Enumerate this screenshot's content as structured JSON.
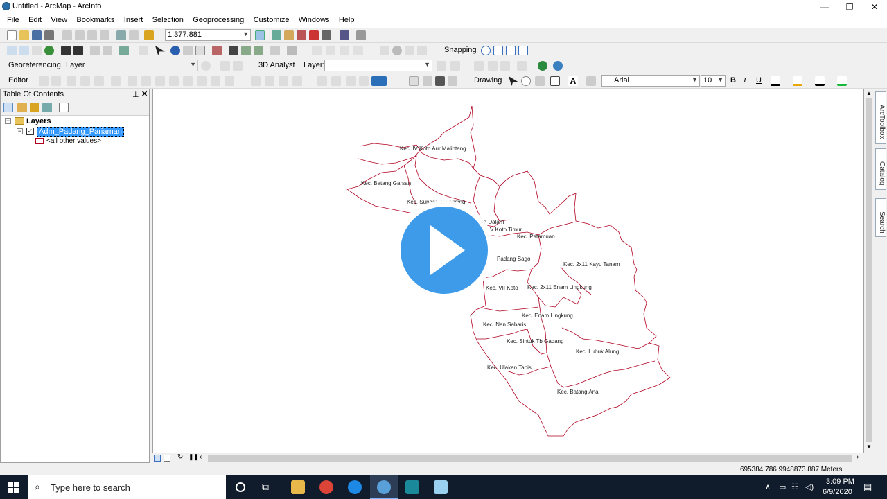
{
  "window": {
    "title": "Untitled - ArcMap - ArcInfo",
    "min": "—",
    "max": "❐",
    "close": "✕"
  },
  "menu": [
    "File",
    "Edit",
    "View",
    "Bookmarks",
    "Insert",
    "Selection",
    "Geoprocessing",
    "Customize",
    "Windows",
    "Help"
  ],
  "toolbar": {
    "scale": "1:377.881",
    "snapping_label": "Snapping",
    "georef_label": "Georeferencing",
    "layer_label": "Layer:",
    "analyst_label": "3D Analyst",
    "layer2_label": "Layer:",
    "editor_label": "Editor",
    "drawing_label": "Drawing",
    "font_name": "Arial",
    "font_size": "10",
    "bold": "B",
    "italic": "I",
    "underline": "U"
  },
  "toc": {
    "title": "Table Of Contents",
    "root": "Layers",
    "layer": "Adm_Padang_Pariaman",
    "legend": "<all other values>"
  },
  "dock_tabs": [
    "ArcToolbox",
    "Catalog",
    "Search"
  ],
  "map": {
    "labels": [
      "Kec. IV Koto Aur Malintang",
      "Kec. Batang Gasan",
      "Kec. Sungai Geringging",
      "Kec. V Koto Dalam",
      "Kec. V Koto Timur",
      "Kec. Patamuan",
      "Kec. Padang Sago",
      "Kec. 2x11 Kayu Tanam",
      "Kec. VII Koto",
      "Kec. 2x11 Enam Lingkung",
      "Kec. Enam Lingkung",
      "Kec. Nan Sabaris",
      "Kec. Sintuk Tb Gadang",
      "Kec. Lubuk Alung",
      "Kec. Ulakan Tapis",
      "Kec. Batang Anai"
    ],
    "label_visible": [
      "Kec. IV Koto Aur Malintang",
      "Kec. Batang Garsan",
      "Kec. Sungai Geringging",
      "oto Dalam",
      "V Koto Timur",
      "Kec. Patamuan",
      "Padang Sago",
      "Kec. 2x11 Kayu Tanam",
      "Kec. VII Koto",
      "Kec. 2x11 Enam Lingkung",
      "Kec. Enam Lingkung",
      "Kec. Nan Sabaris",
      "Kec. Sintuk Tb Gadang",
      "Kec. Lubuk Alung",
      "Kec. Ulakan Tapis",
      "Kec. Batang Anai"
    ]
  },
  "status": {
    "coords": "695384.786  9948873.887 Meters"
  },
  "taskbar": {
    "search_placeholder": "Type here to search",
    "time": "3:09 PM",
    "date": "6/9/2020"
  },
  "colors": {
    "boundary": "#b00020",
    "play": "#3d9be9",
    "selection": "#3399ff"
  }
}
